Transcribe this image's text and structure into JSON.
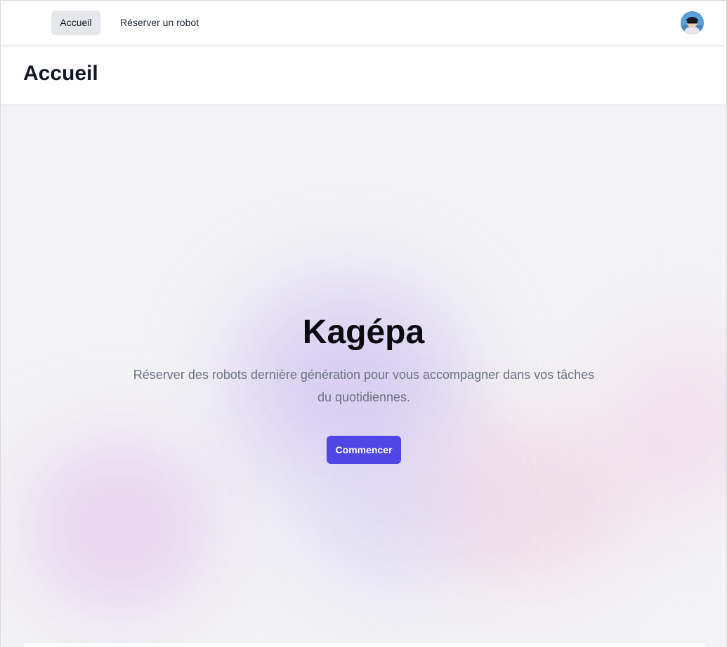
{
  "nav": {
    "links": [
      {
        "label": "Accueil",
        "active": true
      },
      {
        "label": "Réserver un robot",
        "active": false
      }
    ]
  },
  "header": {
    "title": "Accueil"
  },
  "hero": {
    "title": "Kagépa",
    "subtitle": "Réserver des robots dernière génération pour vous accompagner dans vos tâches du quotidiennes.",
    "cta_label": "Commencer"
  },
  "colors": {
    "accent": "#4f46e5",
    "nav_active_bg": "#e6e7ea",
    "subtitle_text": "#6b7280"
  },
  "icons": {
    "avatar": "user-avatar-icon"
  }
}
